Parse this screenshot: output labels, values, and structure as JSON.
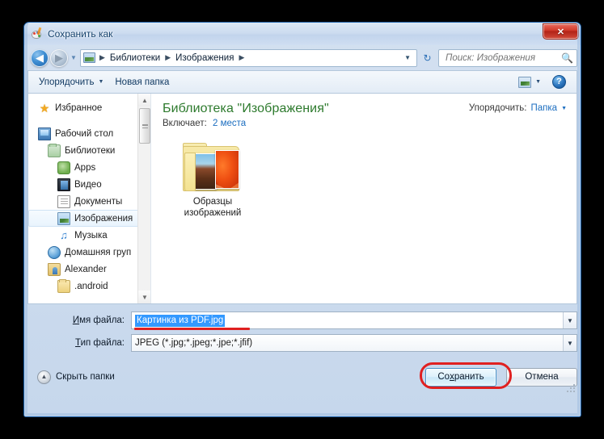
{
  "window": {
    "title": "Сохранить как",
    "app_icon": "paint-palette-icon",
    "close_label": "✕"
  },
  "navbar": {
    "back_glyph": "◀",
    "forward_glyph": "▶",
    "recent_glyph": "▼",
    "address_icon": "picture-library-icon",
    "breadcrumbs": [
      "Библиотеки",
      "Изображения"
    ],
    "separator": "▶",
    "address_dropdown_glyph": "▼",
    "refresh_glyph": "↻",
    "search": {
      "placeholder": "Поиск: Изображения",
      "value": "",
      "icon": "search-icon"
    }
  },
  "commandbar": {
    "organize_label": "Упорядочить",
    "organize_caret": "▼",
    "new_folder_label": "Новая папка",
    "view_icon": "view-layout-icon",
    "view_caret": "▼",
    "help_label": "?"
  },
  "sidebar": {
    "items": [
      {
        "label": "Избранное",
        "icon": "star-icon",
        "indent": 12,
        "selected": false
      },
      {
        "label": "Рабочий стол",
        "icon": "desktop-icon",
        "indent": 12,
        "selected": false
      },
      {
        "label": "Библиотеки",
        "icon": "library-folder-icon",
        "indent": 24,
        "selected": false
      },
      {
        "label": "Apps",
        "icon": "apps-icon",
        "indent": 36,
        "selected": false
      },
      {
        "label": "Видео",
        "icon": "video-library-icon",
        "indent": 36,
        "selected": false
      },
      {
        "label": "Документы",
        "icon": "documents-library-icon",
        "indent": 36,
        "selected": false
      },
      {
        "label": "Изображения",
        "icon": "pictures-library-icon",
        "indent": 36,
        "selected": true
      },
      {
        "label": "Музыка",
        "icon": "music-library-icon",
        "indent": 36,
        "selected": false
      },
      {
        "label": "Домашняя груп",
        "icon": "homegroup-icon",
        "indent": 24,
        "selected": false
      },
      {
        "label": "Alexander",
        "icon": "user-folder-icon",
        "indent": 24,
        "selected": false
      },
      {
        "label": ".android",
        "icon": "folder-icon",
        "indent": 36,
        "selected": false
      }
    ],
    "scrollbar": {
      "up_glyph": "▲",
      "down_glyph": "▼"
    }
  },
  "content": {
    "library_title": "Библиотека \"Изображения\"",
    "includes_label": "Включает:",
    "includes_link": "2 места",
    "arrange_label": "Упорядочить:",
    "arrange_value": "Папка",
    "arrange_caret": "▼",
    "items": [
      {
        "name_line1": "Образцы",
        "name_line2": "изображений",
        "icon": "folder-with-pictures-icon"
      }
    ]
  },
  "form": {
    "filename_label_prefix": "И",
    "filename_label_rest": "мя файла:",
    "filename_value": "Картинка из PDF.jpg",
    "filename_caret": "▼",
    "filetype_label_prefix": "Т",
    "filetype_label_rest": "ип файла:",
    "filetype_value": "JPEG (*.jpg;*.jpeg;*.jpe;*.jfif)",
    "filetype_caret": "▼"
  },
  "footer": {
    "hide_folders_label": "Скрыть папки",
    "hide_folders_glyph": "▲",
    "save_prefix": "Со",
    "save_underlined": "х",
    "save_suffix": "ранить",
    "cancel_label": "Отмена"
  },
  "colors": {
    "accent_blue": "#1c6ec0",
    "library_green": "#2d7a2d",
    "annotation_red": "#e02020",
    "selection_blue": "#3399ff",
    "window_border": "#1a5fa8"
  }
}
